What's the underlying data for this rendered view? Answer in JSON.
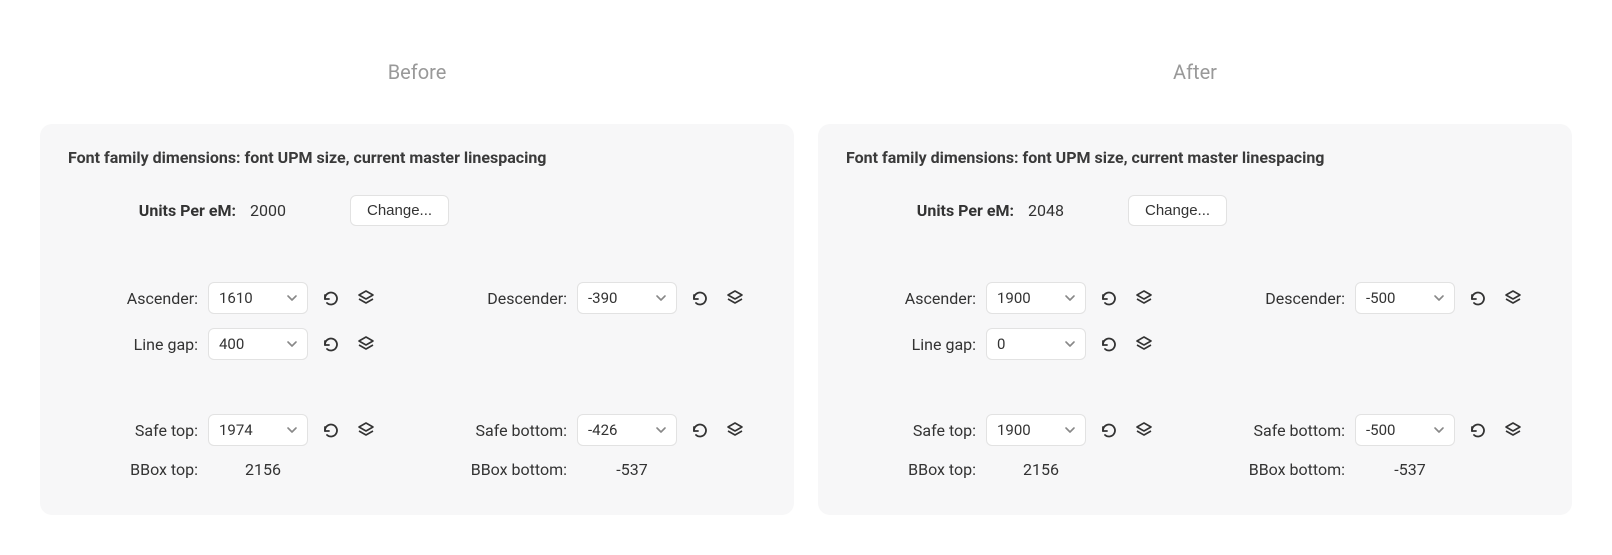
{
  "columns": {
    "before": {
      "title": "Before",
      "heading": "Font family dimensions: font UPM size, current master linespacing",
      "upm": {
        "label": "Units Per eM:",
        "value": "2000",
        "change_btn": "Change..."
      },
      "ascender": {
        "label": "Ascender:",
        "value": "1610"
      },
      "descender": {
        "label": "Descender:",
        "value": "-390"
      },
      "line_gap": {
        "label": "Line gap:",
        "value": "400"
      },
      "safe_top": {
        "label": "Safe top:",
        "value": "1974"
      },
      "safe_bottom": {
        "label": "Safe bottom:",
        "value": "-426"
      },
      "bbox_top": {
        "label": "BBox top:",
        "value": "2156"
      },
      "bbox_bottom": {
        "label": "BBox bottom:",
        "value": "-537"
      }
    },
    "after": {
      "title": "After",
      "heading": "Font family dimensions: font UPM size, current master linespacing",
      "upm": {
        "label": "Units Per eM:",
        "value": "2048",
        "change_btn": "Change..."
      },
      "ascender": {
        "label": "Ascender:",
        "value": "1900"
      },
      "descender": {
        "label": "Descender:",
        "value": "-500"
      },
      "line_gap": {
        "label": "Line gap:",
        "value": "0"
      },
      "safe_top": {
        "label": "Safe top:",
        "value": "1900"
      },
      "safe_bottom": {
        "label": "Safe bottom:",
        "value": "-500"
      },
      "bbox_top": {
        "label": "BBox top:",
        "value": "2156"
      },
      "bbox_bottom": {
        "label": "BBox bottom:",
        "value": "-537"
      }
    }
  }
}
